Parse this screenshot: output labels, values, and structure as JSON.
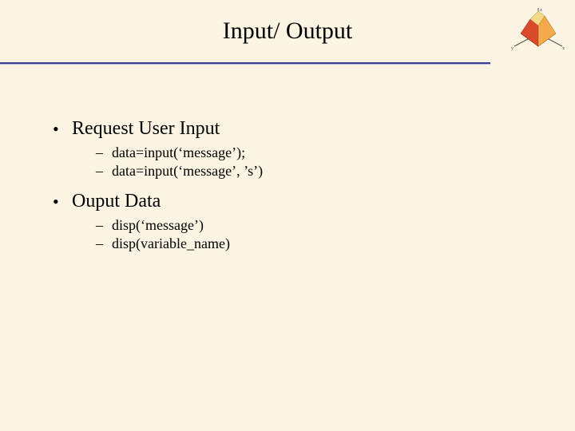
{
  "title": "Input/ Output",
  "bullets": [
    {
      "label": "Request User Input",
      "sub": [
        "data=input(‘message’);",
        "data=input(‘message’, ’s’)"
      ]
    },
    {
      "label": "Ouput Data",
      "sub": [
        "disp(‘message’)",
        "disp(variable_name)"
      ]
    }
  ]
}
